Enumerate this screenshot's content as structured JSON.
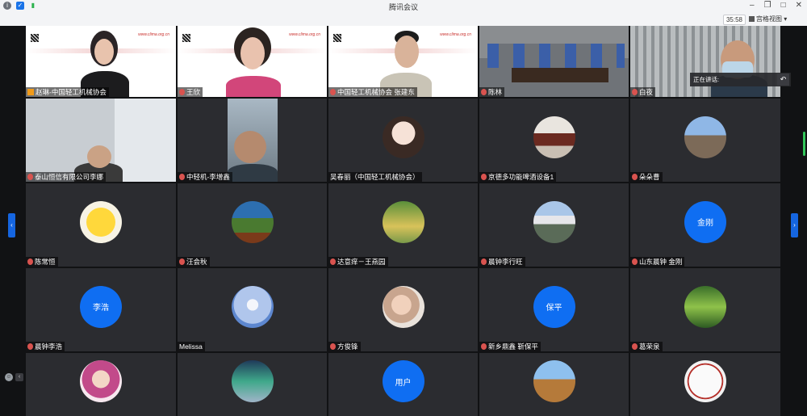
{
  "window": {
    "title": "腾讯会议",
    "timer": "35:58",
    "view_mode": "宫格视图"
  },
  "speaker_popup": {
    "label": "正在讲话:"
  },
  "colors": {
    "accent": "#0f6ef2",
    "tile_bg": "#2b2c30",
    "window_bg": "#111214"
  },
  "slide_url": "www.clima.org.cn",
  "participants": [
    {
      "name": "赵琳-中国轻工机械协会",
      "kind": "video-slide"
    },
    {
      "name": "王欣",
      "kind": "video-slide"
    },
    {
      "name": "中国轻工机械协会 张建东",
      "kind": "video-slide"
    },
    {
      "name": "陈林",
      "kind": "video-room"
    },
    {
      "name": "白夜",
      "kind": "video-person"
    },
    {
      "name": "泰山恒信有限公司李娜",
      "kind": "video-office"
    },
    {
      "name": "中轻机-李增鑫",
      "kind": "video-person"
    },
    {
      "name": "吴春丽（中国轻工机械协会）",
      "kind": "avatar-photo"
    },
    {
      "name": "京德多功能啤酒设备1",
      "kind": "avatar-photo"
    },
    {
      "name": "朵朵曹",
      "kind": "avatar-photo"
    },
    {
      "name": "陈常恒",
      "kind": "avatar-cartoon"
    },
    {
      "name": "汪会秋",
      "kind": "avatar-photo"
    },
    {
      "name": "达意痒－王燕园",
      "kind": "avatar-photo"
    },
    {
      "name": "晨钟李行旺",
      "kind": "avatar-photo"
    },
    {
      "name": "山东晨钟 金刚",
      "kind": "avatar-text",
      "avatar_text": "金刚"
    },
    {
      "name": "晨钟李浩",
      "kind": "avatar-text",
      "avatar_text": "李浩"
    },
    {
      "name": "Melissa",
      "kind": "avatar-photo"
    },
    {
      "name": "方俊锋",
      "kind": "avatar-photo"
    },
    {
      "name": "新乡鼎鑫 靳保平",
      "kind": "avatar-text",
      "avatar_text": "保平"
    },
    {
      "name": "葛荣泉",
      "kind": "avatar-photo"
    },
    {
      "name": "",
      "kind": "avatar-photo"
    },
    {
      "name": "",
      "kind": "avatar-photo"
    },
    {
      "name": "",
      "kind": "avatar-text",
      "avatar_text": "用户"
    },
    {
      "name": "",
      "kind": "avatar-photo"
    },
    {
      "name": "",
      "kind": "avatar-photo"
    }
  ]
}
